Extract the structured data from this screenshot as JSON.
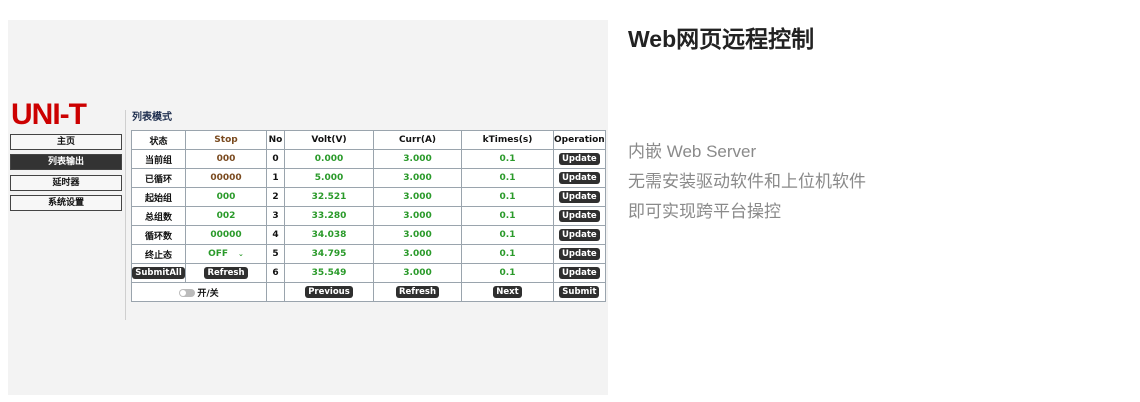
{
  "brand": "UNI-T",
  "mode_title": "列表模式",
  "nav": [
    "主页",
    "列表输出",
    "延时器",
    "系统设置"
  ],
  "table": {
    "headers": [
      "状态",
      "Stop",
      "No",
      "Volt(V)",
      "Curr(A)",
      "kTimes(s)",
      "Operation"
    ],
    "status_rows": [
      {
        "label": "当前组",
        "value": "000"
      },
      {
        "label": "已循环",
        "value": "00000"
      },
      {
        "label": "起始组",
        "value": "000"
      },
      {
        "label": "总组数",
        "value": "002"
      },
      {
        "label": "循环数",
        "value": "00000"
      },
      {
        "label": "终止态",
        "value": "OFF"
      }
    ],
    "rows": [
      {
        "no": "0",
        "volt": "0.000",
        "curr": "3.000",
        "ktimes": "0.1",
        "op": "Update"
      },
      {
        "no": "1",
        "volt": "5.000",
        "curr": "3.000",
        "ktimes": "0.1",
        "op": "Update"
      },
      {
        "no": "2",
        "volt": "32.521",
        "curr": "3.000",
        "ktimes": "0.1",
        "op": "Update"
      },
      {
        "no": "3",
        "volt": "33.280",
        "curr": "3.000",
        "ktimes": "0.1",
        "op": "Update"
      },
      {
        "no": "4",
        "volt": "34.038",
        "curr": "3.000",
        "ktimes": "0.1",
        "op": "Update"
      },
      {
        "no": "5",
        "volt": "34.795",
        "curr": "3.000",
        "ktimes": "0.1",
        "op": "Update"
      },
      {
        "no": "6",
        "volt": "35.549",
        "curr": "3.000",
        "ktimes": "0.1",
        "op": "Update"
      }
    ],
    "submit_all": "SubmitAll",
    "refresh": "Refresh",
    "toggle_label": "开/关",
    "footer": {
      "previous": "Previous",
      "refresh": "Refresh",
      "next": "Next",
      "submit": "Submit"
    }
  },
  "heading": "Web网页远程控制",
  "desc": [
    "内嵌 Web Server",
    "无需安装驱动软件和上位机软件",
    "即可实现跨平台操控"
  ]
}
